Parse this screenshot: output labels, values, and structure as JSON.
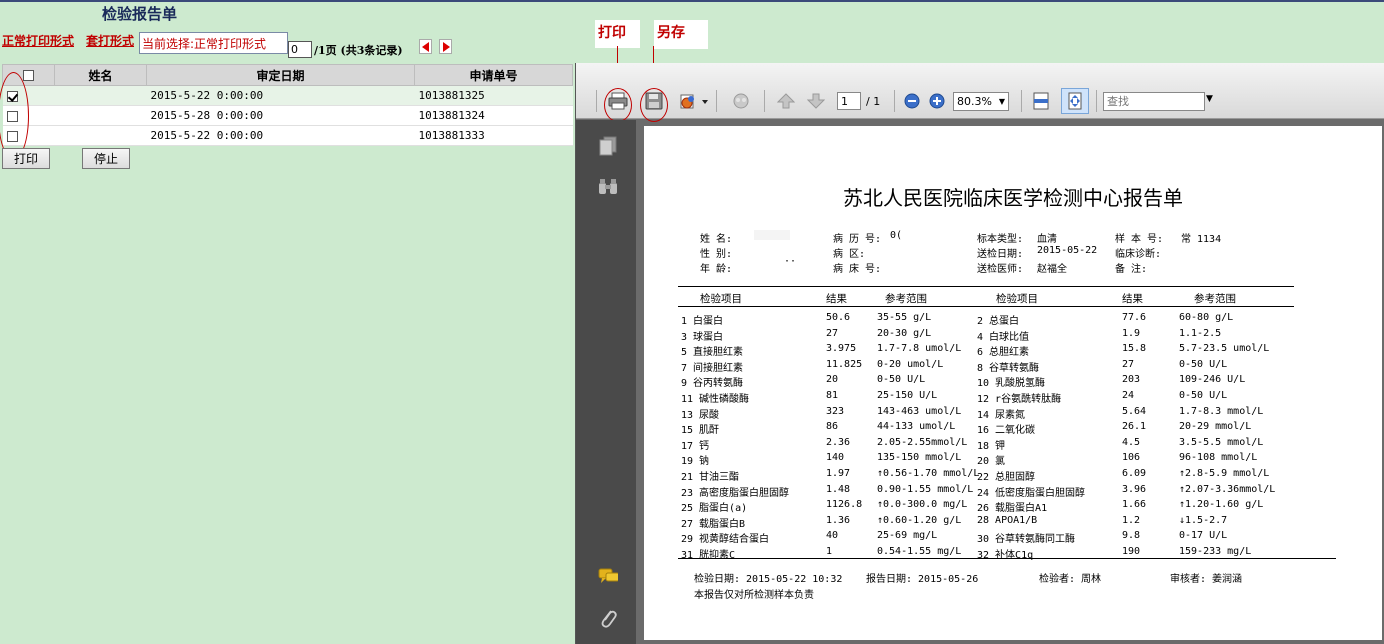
{
  "header": {
    "title": "检验报告单",
    "mode_normal": "正常打印形式",
    "mode_overlay": "套打形式",
    "current_selection": "当前选择:正常打印形式",
    "page_value": "0",
    "page_info": "/1页 (共3条记录)"
  },
  "table": {
    "columns": [
      "姓名",
      "审定日期",
      "申请单号"
    ],
    "rows": [
      {
        "checked": true,
        "name": "",
        "date": "2015-5-22 0:00:00",
        "id": "1013881325"
      },
      {
        "checked": false,
        "name": "",
        "date": "2015-5-28 0:00:00",
        "id": "1013881324"
      },
      {
        "checked": false,
        "name": "",
        "date": "2015-5-22 0:00:00",
        "id": "1013881333"
      }
    ]
  },
  "buttons": {
    "print": "打印",
    "stop": "停止"
  },
  "annotations": {
    "print": "打印",
    "save": "另存"
  },
  "viewer": {
    "page_num": "1",
    "page_total": "/ 1",
    "zoom": "80.3%",
    "find_placeholder": "查找"
  },
  "report": {
    "title": "苏北人民医院临床医学检测中心报告单",
    "info": {
      "name_label": "姓    名:",
      "record_no_label": "病 历 号:",
      "record_no": "0(",
      "sample_type_label": "标本类型:",
      "sample_type": "血清",
      "sample_no_label": "样 本 号:",
      "sample_no": "常 1134",
      "gender_label": "性    别:",
      "ward_label": "病    区:",
      "send_date_label": "送检日期:",
      "send_date": "2015-05-22",
      "diagnosis_label": "临床诊断:",
      "age_label": "年    龄:",
      "age_value": "··",
      "bed_label": "病 床 号:",
      "doctor_label": "送检医师:",
      "doctor": "赵福全",
      "remark_label": "备    注:"
    },
    "headers": [
      "检验项目",
      "结果",
      "参考范围",
      "检验项目",
      "结果",
      "参考范围"
    ],
    "rows": [
      [
        "1  白蛋白",
        "50.6",
        " 35-55 g/L",
        "2  总蛋白",
        "77.6",
        " 60-80 g/L"
      ],
      [
        "3  球蛋白",
        "27",
        " 20-30 g/L",
        "4  白球比值",
        "1.9",
        " 1.1-2.5"
      ],
      [
        "5  直接胆红素",
        "3.975",
        " 1.7-7.8 umol/L",
        "6  总胆红素",
        "15.8",
        " 5.7-23.5 umol/L"
      ],
      [
        "7  间接胆红素",
        "11.825",
        " 0-20 umol/L",
        "8  谷草转氨酶",
        "27",
        " 0-50 U/L"
      ],
      [
        "9  谷丙转氨酶",
        "20",
        " 0-50 U/L",
        "10 乳酸脱氢酶",
        "203",
        " 109-246 U/L"
      ],
      [
        "11 碱性磷酸酶",
        "81",
        " 25-150 U/L",
        "12 r谷氨酰转肽酶",
        "24",
        " 0-50 U/L"
      ],
      [
        "13 尿酸",
        "323",
        " 143-463 umol/L",
        "14 尿素氮",
        "5.64",
        " 1.7-8.3 mmol/L"
      ],
      [
        "15 肌酐",
        "86",
        " 44-133 umol/L",
        "16 二氧化碳",
        "26.1",
        " 20-29 mmol/L"
      ],
      [
        "17 钙",
        "2.36",
        " 2.05-2.55mmol/L",
        "18 钾",
        "4.5",
        " 3.5-5.5 mmol/L"
      ],
      [
        "19 钠",
        "140",
        " 135-150 mmol/L",
        "20 氯",
        "106",
        " 96-108 mmol/L"
      ],
      [
        "21 甘油三酯",
        "1.97",
        "↑0.56-1.70 mmol/L",
        "22 总胆固醇",
        "6.09",
        "↑2.8-5.9 mmol/L"
      ],
      [
        "23 高密度脂蛋白胆固醇",
        "1.48",
        " 0.90-1.55 mmol/L",
        "24 低密度脂蛋白胆固醇",
        "3.96",
        "↑2.07-3.36mmol/L"
      ],
      [
        "25 脂蛋白(a)",
        "1126.8",
        "↑0.0-300.0 mg/L",
        "26 载脂蛋白A1",
        "1.66",
        "↑1.20-1.60 g/L"
      ],
      [
        "27 载脂蛋白B",
        "1.36",
        "↑0.60-1.20 g/L",
        "28 APOA1/B",
        "1.2",
        "↓1.5-2.7"
      ],
      [
        "29 视黄醇结合蛋白",
        "40",
        " 25-69 mg/L",
        "30 谷草转氨酶同工酶",
        "9.8",
        " 0-17 U/L"
      ],
      [
        "31 胱抑素C",
        "1",
        " 0.54-1.55 mg/L",
        "32 补体C1q",
        "190",
        " 159-233 mg/L"
      ]
    ],
    "footer": {
      "test_date": "检验日期:  2015-05-22  10:32",
      "report_date": "报告日期:  2015-05-26",
      "tester": "检验者:   周林",
      "reviewer": "审核者:   姜润涵",
      "note": "本报告仅对所检测样本负责"
    }
  }
}
